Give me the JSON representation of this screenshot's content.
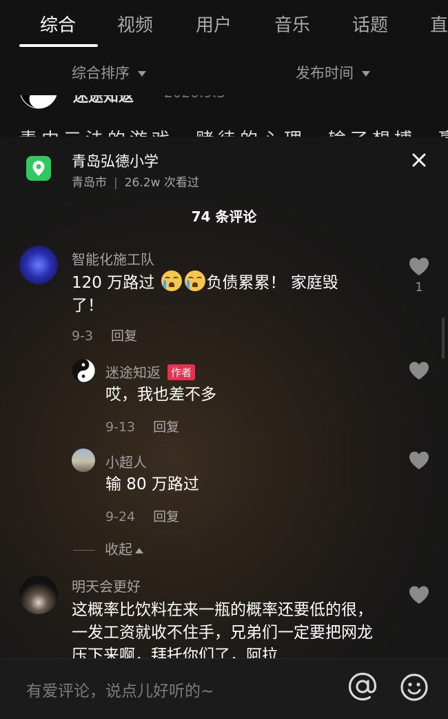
{
  "tabs": [
    {
      "label": "综合",
      "active": true
    },
    {
      "label": "视频"
    },
    {
      "label": "用户"
    },
    {
      "label": "音乐"
    },
    {
      "label": "话题"
    },
    {
      "label": "直"
    }
  ],
  "sort": {
    "left": "综合排序",
    "right": "发布时间"
  },
  "behind": {
    "name": "迷途知返",
    "date": "2020.9.3",
    "text": "青中三法的游戏，赌徒的心理，输了想搏，赢了想"
  },
  "location": {
    "title": "青岛弘德小学",
    "city": "青岛市",
    "sep": "|",
    "views": "26.2w 次看过",
    "icon": "location-pin-icon",
    "icon_color": "#30C960"
  },
  "comment_count": "74 条评论",
  "comments": [
    {
      "name": "智能化施工队",
      "text_a": "120 万路过 ",
      "text_b": "负债累累！ 家庭毁了！",
      "emoji": [
        "crying-face-icon",
        "crying-face-icon"
      ],
      "date": "9-3",
      "reply": "回复",
      "likes": "1"
    },
    {
      "name": "迷途知返",
      "badge": "作者",
      "text": "哎，我也差不多",
      "date": "9-13",
      "reply": "回复"
    },
    {
      "name": "小超人",
      "text": "输 80 万路过",
      "date": "9-24",
      "reply": "回复"
    },
    {
      "name": "明天会更好",
      "text": "这概率比饮料在来一瓶的概率还要低的很，一发工资就收不住手，兄弟们一定要把网龙压下来啊，拜托你们了，阿拉"
    }
  ],
  "collapse": "收起",
  "input": {
    "placeholder": "有爱评论，说点儿好听的~"
  },
  "colors": {
    "accent_badge": "#E8304F",
    "bg": "#161616"
  }
}
